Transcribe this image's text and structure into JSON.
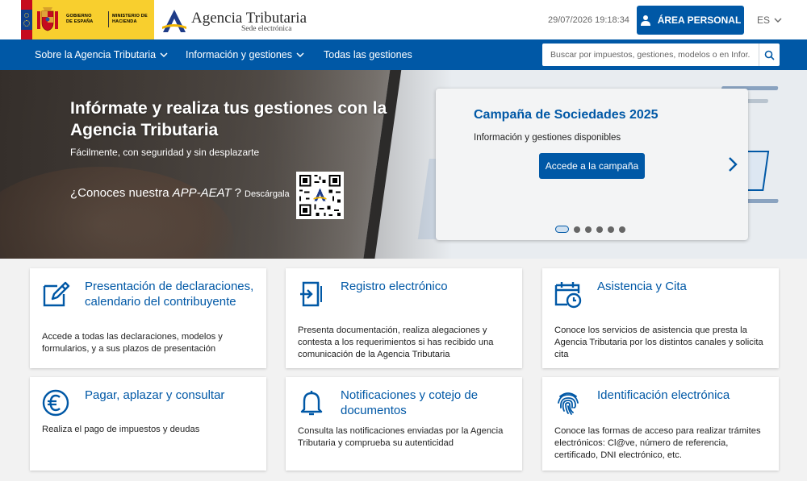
{
  "header": {
    "gov_line1": "GOBIERNO DE ESPAÑA",
    "gov_line2": "MINISTERIO DE HACIENDA",
    "brand_name": "Agencia Tributaria",
    "brand_sub": "Sede electrónica",
    "datetime": "29/07/2026 19:18:34",
    "area_personal": "ÁREA PERSONAL",
    "language": "ES",
    "colors": {
      "primary": "#0058a6",
      "gov_yellow": "#f8cf2e",
      "flag_red": "#c60b1e"
    }
  },
  "nav": {
    "items": [
      {
        "label": "Sobre la Agencia Tributaria",
        "has_dropdown": true
      },
      {
        "label": "Información y gestiones",
        "has_dropdown": true
      },
      {
        "label": "Todas las gestiones",
        "has_dropdown": false
      }
    ],
    "search_placeholder": "Buscar por impuestos, gestiones, modelos o en Infor..."
  },
  "hero": {
    "title": "Infórmate y realiza tus gestiones con la Agencia Tributaria",
    "subtitle": "Fácilmente, con seguridad y sin desplazarte",
    "app_prefix": "¿Conoces nuestra",
    "app_name": "APP-AEAT",
    "app_suffix": "?",
    "app_download": "Descárgala"
  },
  "campaign": {
    "title": "Campaña de Sociedades 2025",
    "subtitle": "Información y gestiones disponibles",
    "button": "Accede a la campaña",
    "slide_count": 6,
    "active_slide": 1
  },
  "cards": [
    {
      "icon": "edit-form-icon",
      "title": "Presentación de declaraciones, calendario del contribuyente",
      "desc": "Accede a todas las declaraciones, modelos y formularios, y a sus plazos de presentación"
    },
    {
      "icon": "document-entry-icon",
      "title": "Registro electrónico",
      "desc": "Presenta documentación, realiza alegaciones y contesta a los requerimientos si has recibido una comunicación de la Agencia Tributaria"
    },
    {
      "icon": "calendar-clock-icon",
      "title": "Asistencia y Cita",
      "desc": "Conoce los servicios de asistencia que presta la Agencia Tributaria por los distintos canales y solicita cita"
    },
    {
      "icon": "euro-icon",
      "title": "Pagar, aplazar y consultar",
      "desc": "Realiza el pago de impuestos y deudas"
    },
    {
      "icon": "bell-icon",
      "title": "Notificaciones y cotejo de documentos",
      "desc": "Consulta las notificaciones enviadas por la Agencia Tributaria y comprueba su autenticidad"
    },
    {
      "icon": "fingerprint-icon",
      "title": "Identificación electrónica",
      "desc": "Conoce las formas de acceso para realizar trámites electrónicos: Cl@ve, número de referencia, certificado, DNI electrónico, etc."
    }
  ]
}
